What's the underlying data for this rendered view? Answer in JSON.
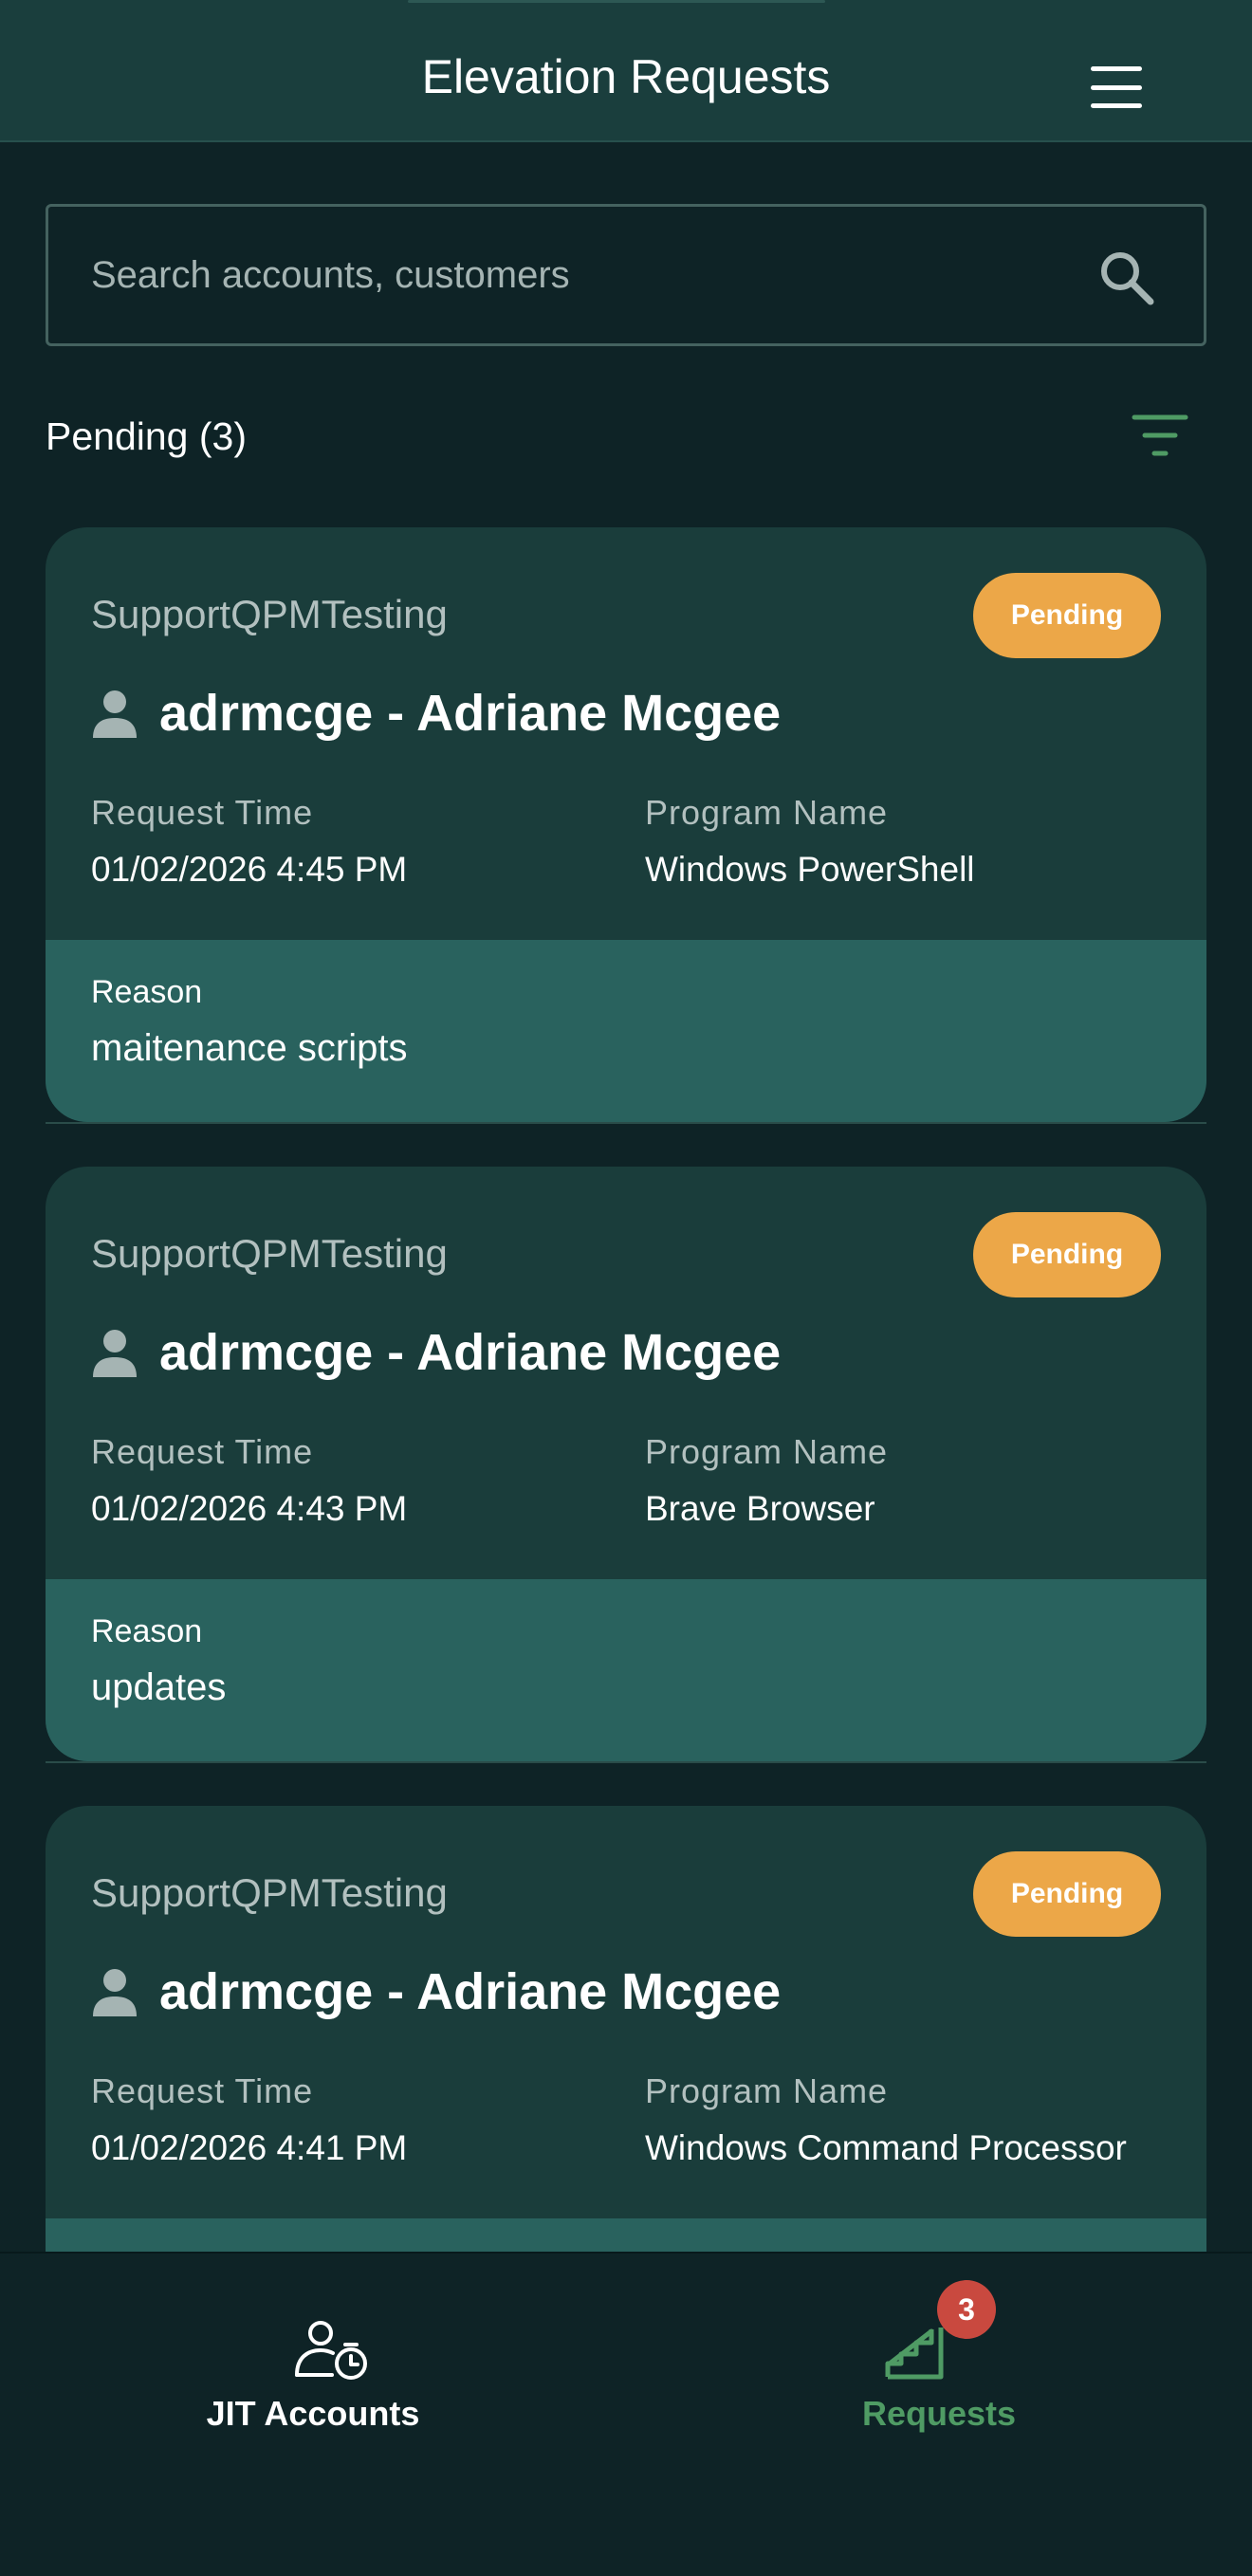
{
  "header": {
    "title": "Elevation Requests",
    "menu_icon": "hamburger-menu-icon"
  },
  "search": {
    "placeholder": "Search accounts, customers",
    "value": "",
    "icon": "search-icon"
  },
  "section": {
    "label": "Pending (3)",
    "filter_icon": "filter-icon"
  },
  "requests": [
    {
      "account": "SupportQPMTesting",
      "status": "Pending",
      "user": "adrmcge - Adriane Mcgee",
      "request_time_label": "Request Time",
      "request_time": "01/02/2026 4:45 PM",
      "program_label": "Program Name",
      "program": "Windows PowerShell",
      "reason_label": "Reason",
      "reason": "maitenance scripts"
    },
    {
      "account": "SupportQPMTesting",
      "status": "Pending",
      "user": "adrmcge - Adriane Mcgee",
      "request_time_label": "Request Time",
      "request_time": "01/02/2026 4:43 PM",
      "program_label": "Program Name",
      "program": "Brave Browser",
      "reason_label": "Reason",
      "reason": "updates"
    },
    {
      "account": "SupportQPMTesting",
      "status": "Pending",
      "user": "adrmcge - Adriane Mcgee",
      "request_time_label": "Request Time",
      "request_time": "01/02/2026 4:41 PM",
      "program_label": "Program Name",
      "program": "Windows Command Processor"
    }
  ],
  "bottom_nav": {
    "items": [
      {
        "label": "JIT Accounts",
        "icon": "user-clock-icon",
        "active": false
      },
      {
        "label": "Requests",
        "icon": "chart-stairs-icon",
        "active": true,
        "badge": "3"
      }
    ]
  },
  "colors": {
    "background": "#0e2326",
    "header": "#1a3e3d",
    "card": "#1a3d3b",
    "reason_band": "#29625e",
    "pending_badge": "#eca748",
    "active_nav": "#4f9b64",
    "count_badge": "#c9493f"
  }
}
